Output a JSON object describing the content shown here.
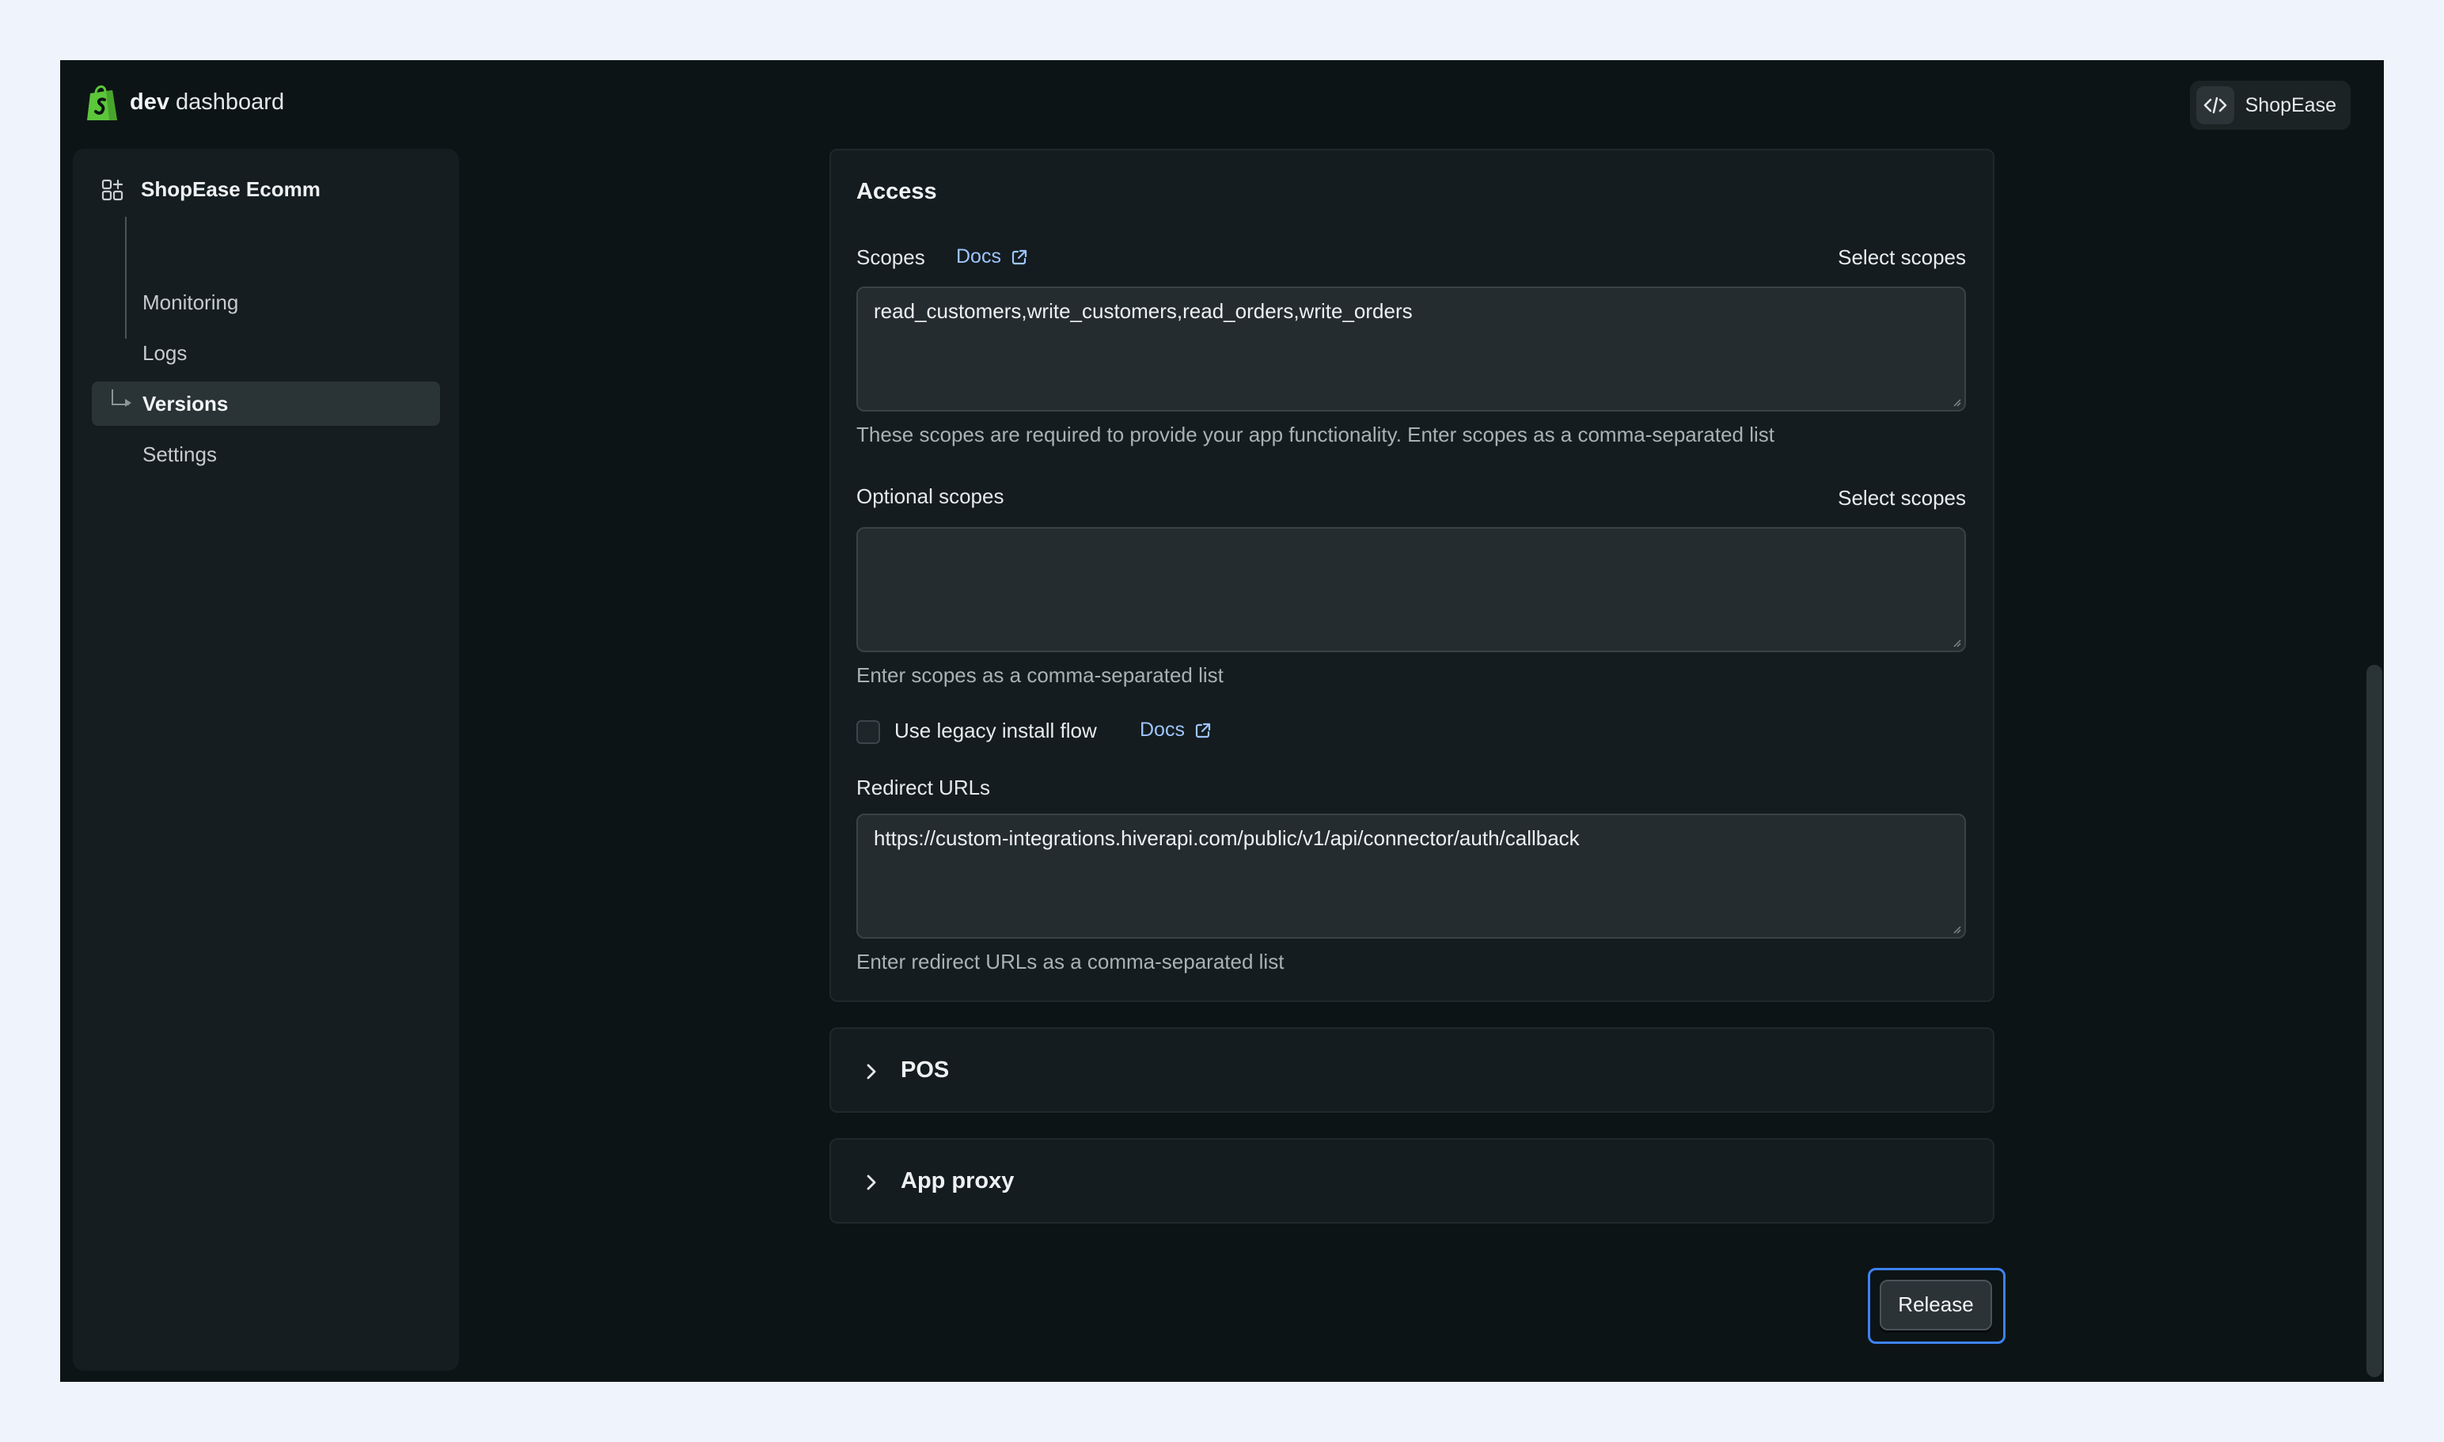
{
  "header": {
    "brand_bold": "dev",
    "brand_rest": " dashboard",
    "store_name": "ShopEase"
  },
  "sidebar": {
    "app_name": "ShopEase Ecomm",
    "items": [
      {
        "label": "Monitoring"
      },
      {
        "label": "Logs"
      },
      {
        "label": "Versions",
        "active": true
      },
      {
        "label": "Settings"
      }
    ]
  },
  "access": {
    "title": "Access",
    "scopes": {
      "label": "Scopes",
      "docs_label": "Docs",
      "select_label": "Select scopes",
      "value": "read_customers,write_customers,read_orders,write_orders",
      "help": "These scopes are required to provide your app functionality. Enter scopes as a comma-separated list"
    },
    "optional_scopes": {
      "label": "Optional scopes",
      "select_label": "Select scopes",
      "value": "",
      "help": "Enter scopes as a comma-separated list"
    },
    "legacy_install": {
      "label": "Use legacy install flow",
      "docs_label": "Docs",
      "checked": false
    },
    "redirect_urls": {
      "label": "Redirect URLs",
      "value": "https://custom-integrations.hiverapi.com/public/v1/api/connector/auth/callback",
      "help": "Enter redirect URLs as a comma-separated list"
    }
  },
  "sections": {
    "pos": "POS",
    "app_proxy": "App proxy"
  },
  "actions": {
    "release_label": "Release"
  },
  "colors": {
    "background": "#0d1416",
    "panel": "#141c1f",
    "link": "#9ec5ff",
    "focus_ring": "#3d82f6",
    "shopify_green": "#5cc73a"
  }
}
